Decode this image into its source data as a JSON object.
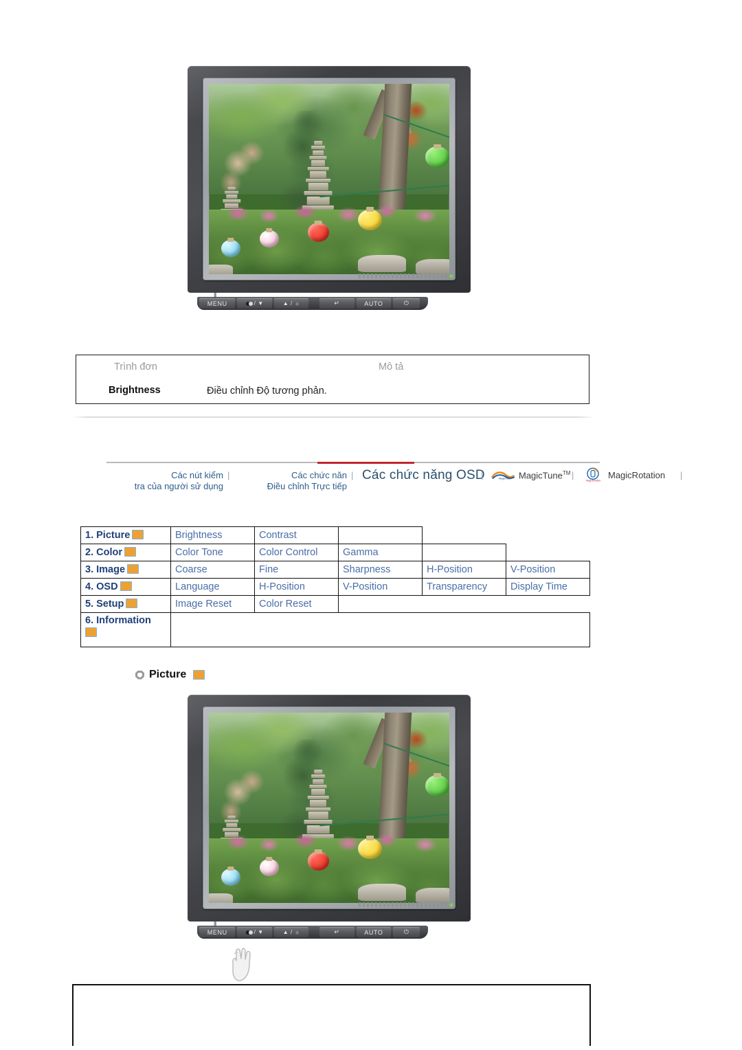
{
  "page": {
    "language": "vi",
    "accent_red": "#c0272d",
    "link_blue": "#2f5c8a",
    "cell_blue": "#4a6ea8",
    "icon_orange": "#f0a030",
    "icon_border": "#79b6e8"
  },
  "monitor": {
    "buttons": [
      {
        "name": "menu",
        "label": "MENU"
      },
      {
        "name": "magicbright-down",
        "label": "/ ▼",
        "icon": "magicbright-icon"
      },
      {
        "name": "up-brightness",
        "label": "▲ / ☼"
      },
      {
        "name": "source-enter",
        "label": "↵"
      },
      {
        "name": "auto",
        "label": "AUTO"
      },
      {
        "name": "power",
        "label": "⏻"
      }
    ],
    "screen_description": "Korean temple garden with stone pagoda, trees and colored paper lanterns"
  },
  "menu_table": {
    "headers": {
      "menu": "Trình đơn",
      "description": "Mô tả"
    },
    "rows": [
      {
        "menu": "Brightness",
        "description": "Điều chỉnh Độ tương phản."
      }
    ]
  },
  "nav": {
    "items": [
      {
        "id": "user-control-buttons",
        "line1": "Các nút kiểm",
        "line2": "tra của người sử dụng",
        "active": false
      },
      {
        "id": "direct-adjust",
        "line1": "Các chức năn",
        "line2": "Điều chỉnh Trực tiếp",
        "active": false
      },
      {
        "id": "osd-functions",
        "line1": "Các chức năng OSD",
        "line2": "",
        "active": true
      },
      {
        "id": "magictune",
        "line1": "MagicTune",
        "line2": "",
        "tm": "TM",
        "active": false
      },
      {
        "id": "magicrotation",
        "line1": "MagicRotation",
        "line2": "",
        "active": false
      }
    ],
    "separator": "|"
  },
  "osd_table": {
    "rows": [
      {
        "label": "1. Picture",
        "icon": "picture-icon",
        "items": [
          "Brightness",
          "Contrast"
        ]
      },
      {
        "label": "2. Color",
        "icon": "color-icon",
        "items": [
          "Color Tone",
          "Color Control",
          "Gamma"
        ]
      },
      {
        "label": "3. Image",
        "icon": "image-icon",
        "items": [
          "Coarse",
          "Fine",
          "Sharpness",
          "H-Position",
          "V-Position"
        ]
      },
      {
        "label": "4. OSD",
        "icon": "osd-icon",
        "items": [
          "Language",
          "H-Position",
          "V-Position",
          "Transparency",
          "Display Time"
        ]
      },
      {
        "label": "5. Setup",
        "icon": "setup-icon",
        "items": [
          "Image Reset",
          "Color Reset"
        ]
      },
      {
        "label": "6. Information",
        "icon": "information-icon",
        "items": []
      }
    ]
  },
  "section": {
    "title": "Picture",
    "icon": "picture-icon"
  }
}
